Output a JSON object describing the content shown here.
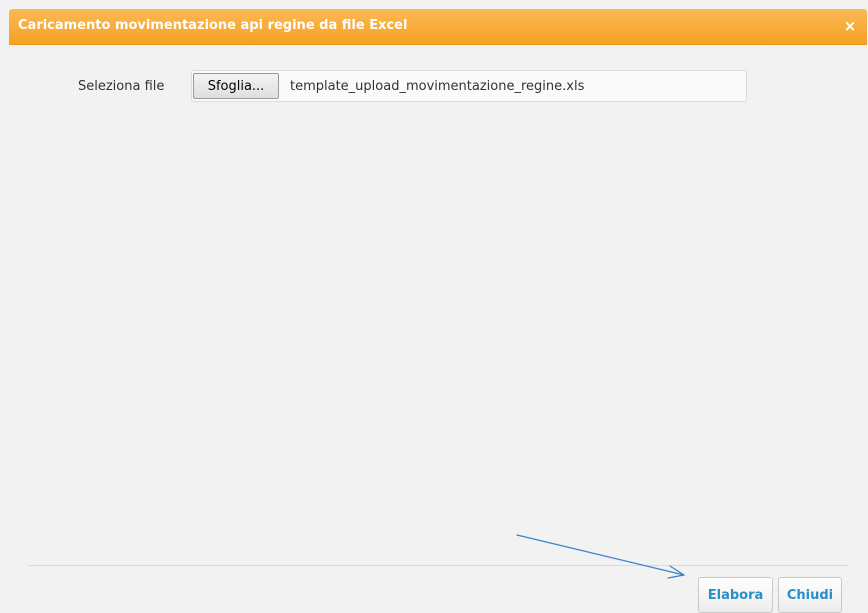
{
  "dialog": {
    "title": "Caricamento movimentazione api regine da file Excel",
    "close_icon": "close-icon",
    "close_glyph": "×"
  },
  "form": {
    "file_label": "Seleziona file",
    "browse_label": "Sfoglia...",
    "file_name": "template_upload_movimentazione_regine.xls"
  },
  "footer": {
    "elabora_label": "Elabora",
    "chiudi_label": "Chiudi"
  },
  "annotation": {
    "arrow_icon": "annotation-arrow",
    "arrow_color": "#3a7fd0"
  },
  "colors": {
    "title_bar": "#f5a123",
    "button_text": "#2a8fc6",
    "body_background": "#f2f2f2"
  }
}
